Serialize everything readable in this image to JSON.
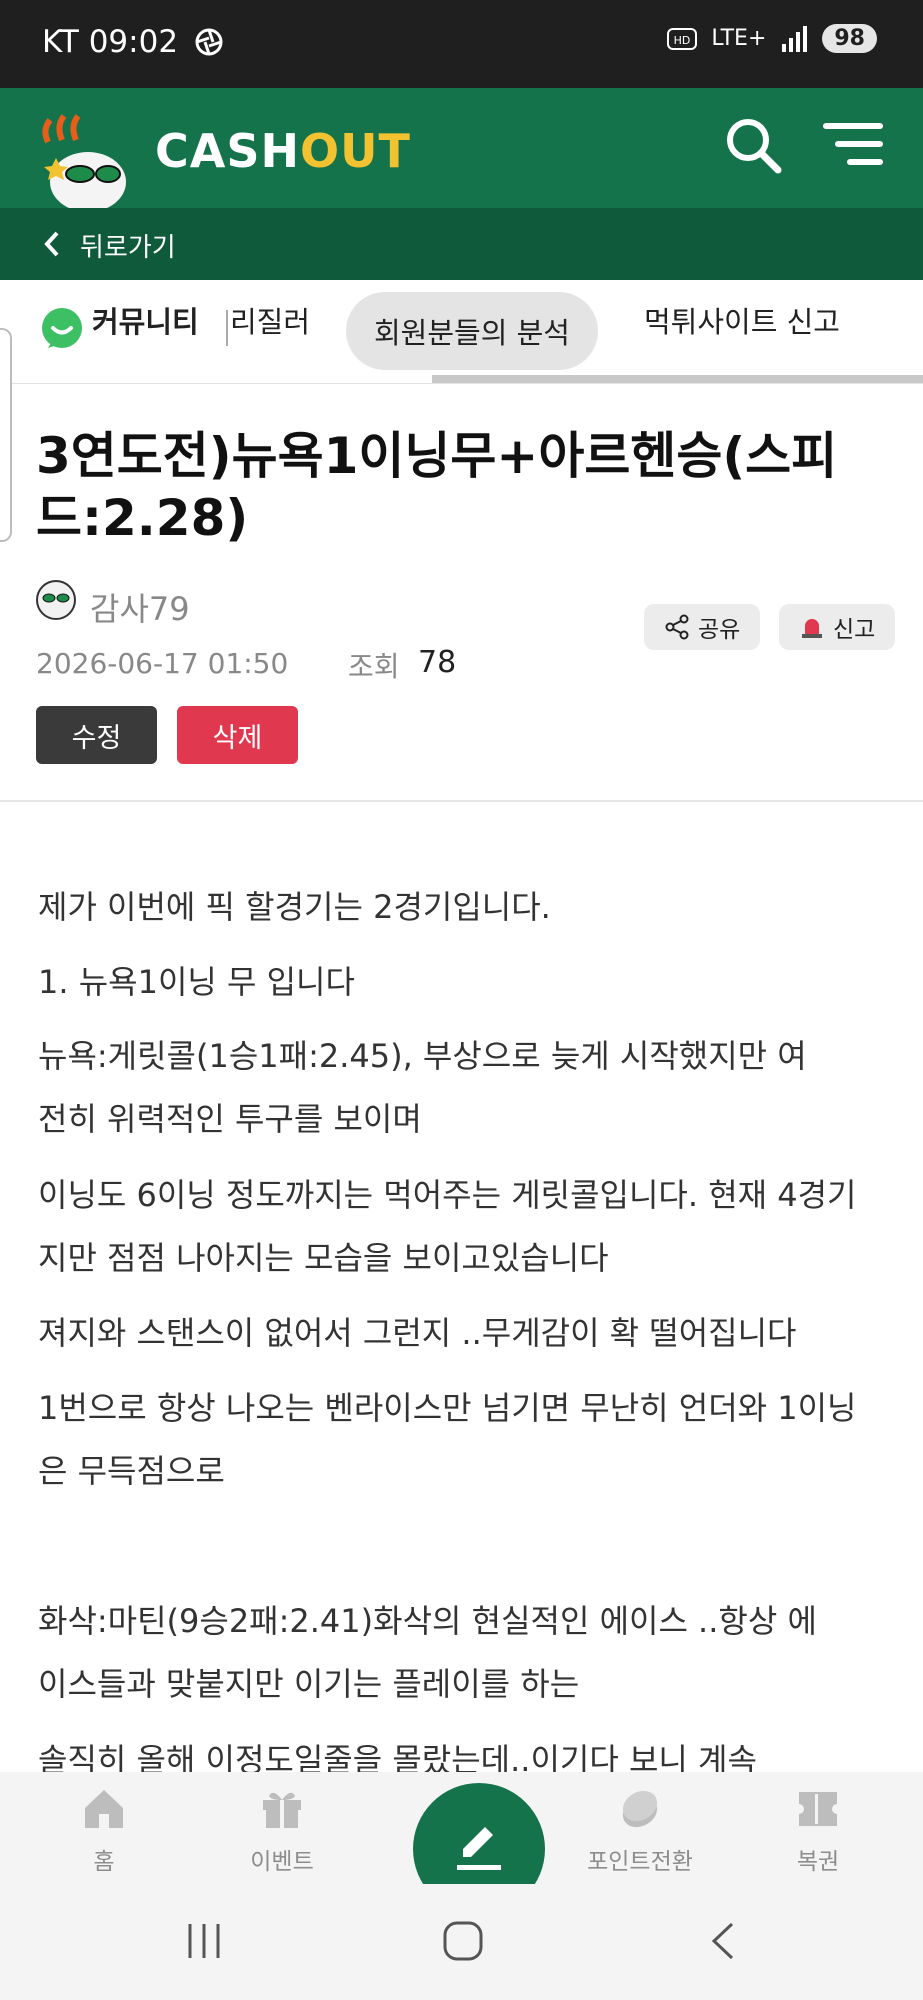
{
  "status_bar": {
    "carrier_time": "KT 09:02",
    "network": "LTE+",
    "battery": "98"
  },
  "header": {
    "logo_text_a": "CASH",
    "logo_text_b": "OUT",
    "back_label": "뒤로가기"
  },
  "tabs": [
    {
      "label": "커뮤니티"
    },
    {
      "label": "리질러"
    },
    {
      "label": "회원분들의 분석"
    },
    {
      "label": "먹튀사이트 신고"
    }
  ],
  "post": {
    "title": "3연도전)뉴욕1이닝무+아르헨승(스피드:2.28)",
    "author": "감사79",
    "date": "2026-06-17 01:50",
    "views_label": "조회",
    "views": "78",
    "share_label": "공유",
    "report_label": "신고",
    "edit_label": "수정",
    "delete_label": "삭제",
    "paragraphs": [
      "제가 이번에 픽 할경기는 2경기입니다.",
      "1. 뉴욕1이닝 무 입니다",
      "뉴욕:게릿콜(1승1패:2.45), 부상으로 늦게 시작했지만 여전히 위력적인 투구를 보이며",
      "이닝도 6이닝 정도까지는 먹어주는 게릿콜입니다. 현재 4경기지만 점점 나아지는 모습을 보이고있습니다",
      "져지와 스탠스이 없어서 그런지 ..무게감이 확 떨어집니다",
      "1번으로 항상 나오는 벤라이스만 넘기면 무난히 언더와 1이닝은 무득점으로",
      "화삭:마틴(9승2패:2.41)화삭의 현실적인 에이스 ..항상 에이스들과 맞붙지만 이기는 플레이를 하는",
      "솔직히 올해 이정도일줄을 몰랐는데..이기다 보니 계속"
    ]
  },
  "bottom_nav": [
    {
      "label": "홈",
      "icon": "home-icon"
    },
    {
      "label": "이벤트",
      "icon": "gift-icon"
    },
    {
      "label": "포인트전환",
      "icon": "coin-icon"
    },
    {
      "label": "복권",
      "icon": "ticket-icon"
    }
  ],
  "colors": {
    "brand": "#15734c",
    "brand_dark": "#0f5a3b",
    "accent": "#f2c230",
    "delete": "#e0384e",
    "edit": "#3a3a3a"
  }
}
